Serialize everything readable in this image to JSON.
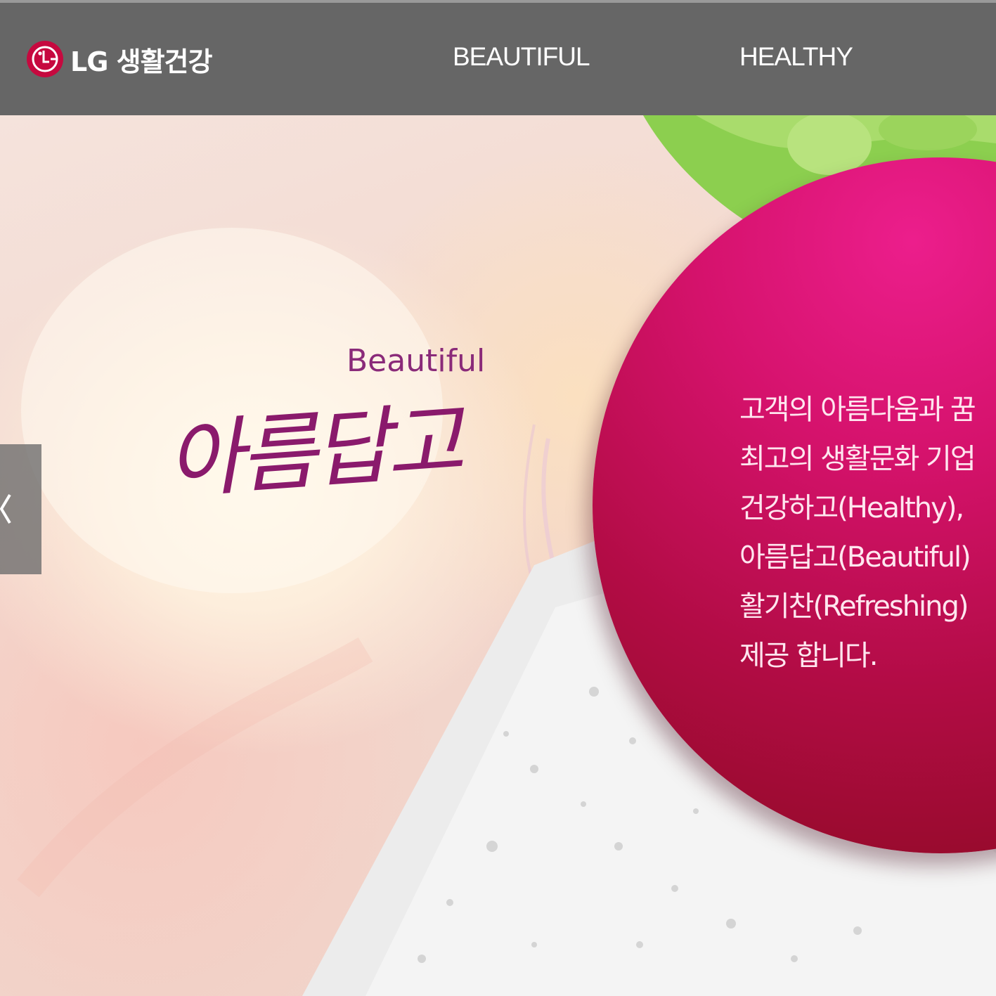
{
  "header": {
    "logo_text": "LG 생활건강",
    "nav": [
      {
        "label": "BEAUTIFUL"
      },
      {
        "label": "HEALTHY"
      }
    ]
  },
  "hero": {
    "slogan_en": "Beautiful",
    "slogan_ko": "아름답고",
    "description_lines": [
      "고객의 아름다움과 꿈",
      "최고의 생활문화 기업",
      "건강하고(Healthy),",
      "아름답고(Beautiful)",
      "활기찬(Refreshing)",
      "제공 합니다."
    ],
    "prev_icon": "chevron-left-icon"
  },
  "colors": {
    "header_bg": "#666666",
    "brand_red": "#c6093f",
    "circle_magenta": "#d5126c",
    "slogan_purple": "#8a1a6c"
  }
}
